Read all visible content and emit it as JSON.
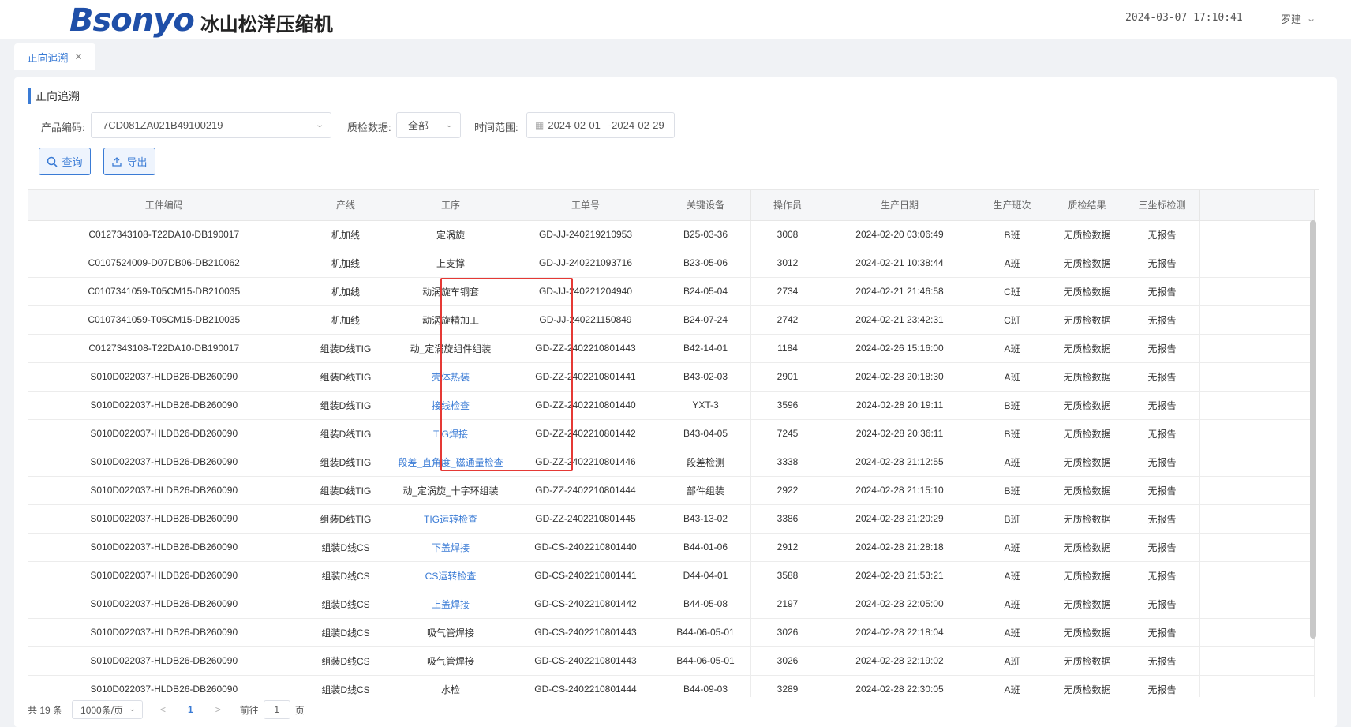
{
  "header": {
    "logo_mark": "Bsonyo",
    "logo_text": "冰山松洋压缩机",
    "datetime": "2024-03-07 17:10:41",
    "user_name": "罗建"
  },
  "tabs": [
    {
      "label": "正向追溯"
    }
  ],
  "section_title": "正向追溯",
  "filters": {
    "product_code_label": "产品编码:",
    "product_code_value": "7CD081ZA021B49100219",
    "qc_data_label": "质检数据:",
    "qc_data_value": "全部",
    "time_range_label": "时间范围:",
    "time_start": "2024-02-01",
    "time_end": "-2024-02-29"
  },
  "buttons": {
    "query": "查询",
    "export": "导出"
  },
  "table": {
    "columns": [
      "工件编码",
      "产线",
      "工序",
      "工单号",
      "关键设备",
      "操作员",
      "生产日期",
      "生产班次",
      "质检结果",
      "三坐标检测"
    ],
    "rows": [
      [
        "C0127343108-T22DA10-DB190017",
        "机加线",
        "定涡旋",
        "GD-JJ-240219210953",
        "B25-03-36",
        "3008",
        "2024-02-20 03:06:49",
        "B班",
        "无质检数据",
        "无报告"
      ],
      [
        "C0107524009-D07DB06-DB210062",
        "机加线",
        "上支撑",
        "GD-JJ-240221093716",
        "B23-05-06",
        "3012",
        "2024-02-21 10:38:44",
        "A班",
        "无质检数据",
        "无报告"
      ],
      [
        "C0107341059-T05CM15-DB210035",
        "机加线",
        "动涡旋车铜套",
        "GD-JJ-240221204940",
        "B24-05-04",
        "2734",
        "2024-02-21 21:46:58",
        "C班",
        "无质检数据",
        "无报告"
      ],
      [
        "C0107341059-T05CM15-DB210035",
        "机加线",
        "动涡旋精加工",
        "GD-JJ-240221150849",
        "B24-07-24",
        "2742",
        "2024-02-21 23:42:31",
        "C班",
        "无质检数据",
        "无报告"
      ],
      [
        "C0127343108-T22DA10-DB190017",
        "组装D线TIG",
        "动_定涡旋组件组装",
        "GD-ZZ-2402210801443",
        "B42-14-01",
        "1184",
        "2024-02-26 15:16:00",
        "A班",
        "无质检数据",
        "无报告"
      ],
      [
        "S010D022037-HLDB26-DB260090",
        "组装D线TIG",
        "壳体热装",
        "GD-ZZ-2402210801441",
        "B43-02-03",
        "2901",
        "2024-02-28 20:18:30",
        "A班",
        "无质检数据",
        "无报告"
      ],
      [
        "S010D022037-HLDB26-DB260090",
        "组装D线TIG",
        "接线检查",
        "GD-ZZ-2402210801440",
        "YXT-3",
        "3596",
        "2024-02-28 20:19:11",
        "B班",
        "无质检数据",
        "无报告"
      ],
      [
        "S010D022037-HLDB26-DB260090",
        "组装D线TIG",
        "TIG焊接",
        "GD-ZZ-2402210801442",
        "B43-04-05",
        "7245",
        "2024-02-28 20:36:11",
        "B班",
        "无质检数据",
        "无报告"
      ],
      [
        "S010D022037-HLDB26-DB260090",
        "组装D线TIG",
        "段差_直角度_磁通量检查",
        "GD-ZZ-2402210801446",
        "段差检测",
        "3338",
        "2024-02-28 21:12:55",
        "A班",
        "无质检数据",
        "无报告"
      ],
      [
        "S010D022037-HLDB26-DB260090",
        "组装D线TIG",
        "动_定涡旋_十字环组装",
        "GD-ZZ-2402210801444",
        "部件组装",
        "2922",
        "2024-02-28 21:15:10",
        "B班",
        "无质检数据",
        "无报告"
      ],
      [
        "S010D022037-HLDB26-DB260090",
        "组装D线TIG",
        "TIG运转检查",
        "GD-ZZ-2402210801445",
        "B43-13-02",
        "3386",
        "2024-02-28 21:20:29",
        "B班",
        "无质检数据",
        "无报告"
      ],
      [
        "S010D022037-HLDB26-DB260090",
        "组装D线CS",
        "下盖焊接",
        "GD-CS-2402210801440",
        "B44-01-06",
        "2912",
        "2024-02-28 21:28:18",
        "A班",
        "无质检数据",
        "无报告"
      ],
      [
        "S010D022037-HLDB26-DB260090",
        "组装D线CS",
        "CS运转检查",
        "GD-CS-2402210801441",
        "D44-04-01",
        "3588",
        "2024-02-28 21:53:21",
        "A班",
        "无质检数据",
        "无报告"
      ],
      [
        "S010D022037-HLDB26-DB260090",
        "组装D线CS",
        "上盖焊接",
        "GD-CS-2402210801442",
        "B44-05-08",
        "2197",
        "2024-02-28 22:05:00",
        "A班",
        "无质检数据",
        "无报告"
      ],
      [
        "S010D022037-HLDB26-DB260090",
        "组装D线CS",
        "吸气管焊接",
        "GD-CS-2402210801443",
        "B44-06-05-01",
        "3026",
        "2024-02-28 22:18:04",
        "A班",
        "无质检数据",
        "无报告"
      ],
      [
        "S010D022037-HLDB26-DB260090",
        "组装D线CS",
        "吸气管焊接",
        "GD-CS-2402210801443",
        "B44-06-05-01",
        "3026",
        "2024-02-28 22:19:02",
        "A班",
        "无质检数据",
        "无报告"
      ],
      [
        "S010D022037-HLDB26-DB260090",
        "组装D线CS",
        "水检",
        "GD-CS-2402210801444",
        "B44-09-03",
        "3289",
        "2024-02-28 22:30:05",
        "A班",
        "无质检数据",
        "无报告"
      ]
    ],
    "link_rows": [
      5,
      6,
      7,
      8,
      10,
      11,
      12,
      13
    ]
  },
  "pagination": {
    "total": "共 19 条",
    "page_size": "1000条/页",
    "prev": "<",
    "current": "1",
    "next": ">",
    "goto_label": "前往",
    "goto_value": "1",
    "page_suffix": "页"
  },
  "colors": {
    "accent": "#3a7bd5",
    "highlight": "#e53935"
  }
}
